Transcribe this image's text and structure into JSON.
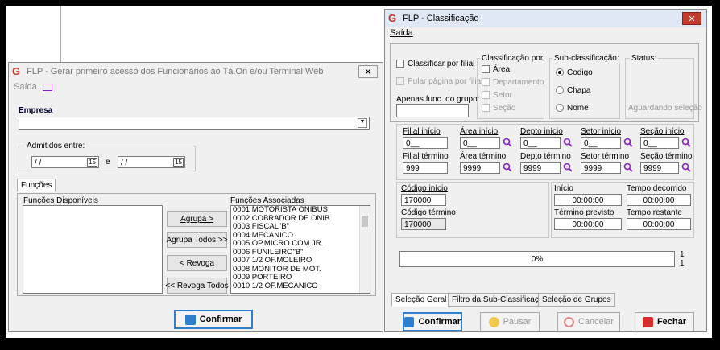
{
  "left_window": {
    "title": "FLP - Gerar primeiro acesso dos Funcionários ao Tá.On e/ou Terminal Web",
    "menu_saida": "Saída",
    "empresa_label": "Empresa",
    "admitidos_label": "Admitidos entre:",
    "date_from": "/ /",
    "date_to": "/ /",
    "and_label": "e",
    "tab_funcoes": "Funções",
    "disponiveis_label": "Funções Disponíveis",
    "associadas_label": "Funções Associadas",
    "btn_agrupa": "Agrupa >",
    "btn_agrupa_todos": "Agrupa Todos >>",
    "btn_revoga": "< Revoga",
    "btn_revoga_todos": "<< Revoga Todos",
    "associadas": [
      "0001 MOTORISTA ONIBUS",
      "0002 COBRADOR DE ONIB",
      "0003 FISCAL\"B\"",
      "0004 MECANICO",
      "0005 OP.MICRO COM.JR.",
      "0006 FUNILEIRO\"B\"",
      "0007 1/2 OF.MOLEIRO",
      "0008 MONITOR DE MOT.",
      "0009 PORTEIRO",
      "0010 1/2 OF.MECANICO"
    ],
    "confirmar": "Confirmar",
    "cal_icon_text": "15"
  },
  "right_window": {
    "title": "FLP - Classificação",
    "menu_saida": "Saída",
    "classificar_filial": "Classificar por filial",
    "pular_pagina": "Pular página por filial",
    "apenas_func": "Apenas func. do grupo:",
    "classificacao_por": "Classificação por:",
    "opt_area": "Área",
    "opt_departamento": "Departamento",
    "opt_setor": "Setor",
    "opt_secao": "Seção",
    "sub_classificacao": "Sub-classificação:",
    "sub_codigo": "Codigo",
    "sub_chapa": "Chapa",
    "sub_nome": "Nome",
    "status_label": "Status:",
    "status_value": "Aguardando seleção",
    "filial_inicio": "Filial início",
    "filial_inicio_val": "0__",
    "filial_termino": "Filial término",
    "filial_termino_val": "999",
    "area_inicio": "Área início",
    "area_inicio_val": "0__",
    "area_termino": "Área término",
    "area_termino_val": "9999",
    "depto_inicio": "Depto início",
    "depto_inicio_val": "0__",
    "depto_termino": "Depto término",
    "depto_termino_val": "9999",
    "setor_inicio": "Setor início",
    "setor_inicio_val": "0__",
    "setor_termino": "Setor término",
    "setor_termino_val": "9999",
    "secao_inicio": "Seção início",
    "secao_inicio_val": "0__",
    "secao_termino": "Seção término",
    "secao_termino_val": "9999",
    "codigo_inicio": "Código início",
    "codigo_inicio_val": "170000",
    "codigo_termino": "Código término",
    "codigo_termino_val": "170000",
    "inicio": "Início",
    "inicio_val": "00:00:00",
    "tempo_decorrido": "Tempo decorrido",
    "tempo_decorrido_val": "00:00:00",
    "termino_previsto": "Término previsto",
    "termino_previsto_val": "00:00:00",
    "tempo_restante": "Tempo restante",
    "tempo_restante_val": "00:00:00",
    "progress_text": "0%",
    "progress_count_top": "1",
    "progress_count_bottom": "1",
    "tab_selecao_geral": "Seleção Geral",
    "tab_filtro_sub": "Filtro da Sub-Classificação",
    "tab_selecao_grupos": "Seleção de Grupos",
    "btn_confirmar": "Confirmar",
    "btn_pausar": "Pausar",
    "btn_cancelar": "Cancelar",
    "btn_fechar": "Fechar"
  },
  "colors": {
    "accent": "#2f7fd0",
    "magnifier": "#8b1fc8",
    "logo": "#c0392b"
  }
}
